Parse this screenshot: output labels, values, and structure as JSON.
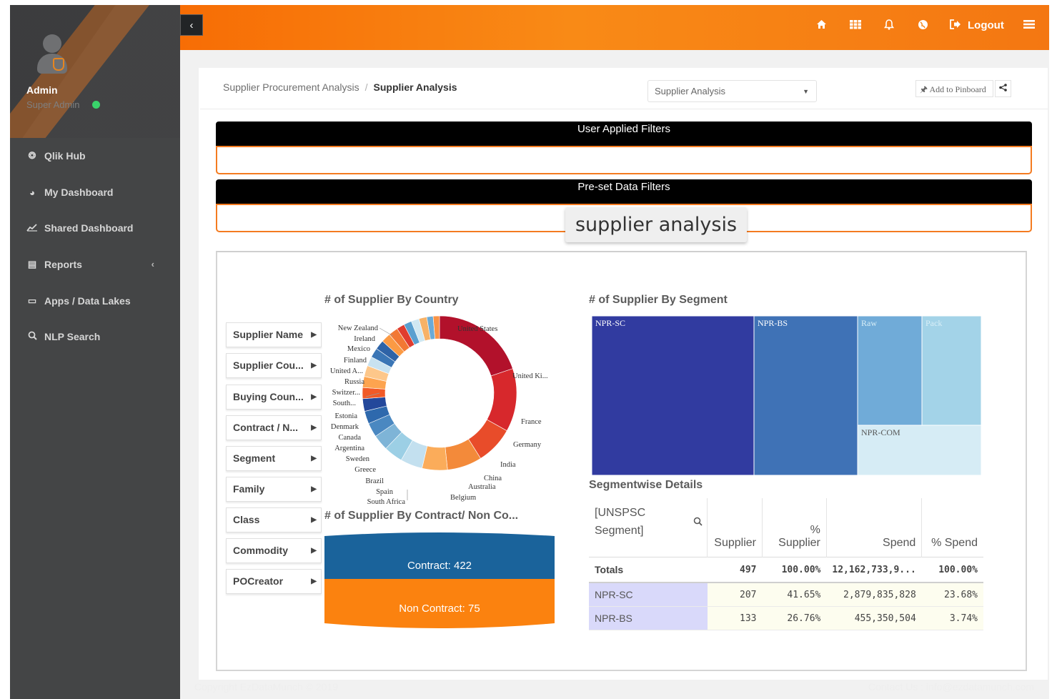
{
  "sidebar": {
    "user_name": "Admin",
    "user_role": "Super Admin",
    "items": [
      {
        "label": "Qlik Hub",
        "icon": "qlik-hub-icon"
      },
      {
        "label": "My Dashboard",
        "icon": "dashboard-icon"
      },
      {
        "label": "Shared Dashboard",
        "icon": "line-chart-icon"
      },
      {
        "label": "Reports",
        "icon": "report-icon"
      },
      {
        "label": "Apps / Data Lakes",
        "icon": "monitor-icon"
      },
      {
        "label": "NLP Search",
        "icon": "search-icon"
      }
    ]
  },
  "topbar": {
    "logout_label": "Logout",
    "icons": [
      "home-icon",
      "grid-icon",
      "bell-icon",
      "globe-icon",
      "logout-icon",
      "menu-icon"
    ]
  },
  "breadcrumb": {
    "parent": "Supplier Procurement Analysis",
    "current": "Supplier Analysis"
  },
  "sheet_select": {
    "value": "Supplier Analysis"
  },
  "pinboard_label": "Add to Pinboard",
  "filters": {
    "user_applied_title": "User Applied Filters",
    "preset_title": "Pre-set Data Filters"
  },
  "tooltip_text": "supplier analysis",
  "listboxes": [
    "Supplier Name",
    "Supplier Cou...",
    "Buying Coun...",
    "Contract / N...",
    "Segment",
    "Family",
    "Class",
    "Commodity",
    "POCreator"
  ],
  "country_chart": {
    "title": "# of Supplier By Country",
    "labels_left": [
      "New Zealand",
      "Ireland",
      "Mexico",
      "Finland",
      "United A...",
      "Russia",
      "Switzer...",
      "South...",
      "Estonia",
      "Denmark",
      "Canada",
      "Argentina",
      "Sweden",
      "Greece",
      "Brazil",
      "Spain",
      "South Africa"
    ],
    "labels_right": [
      "United States",
      "United Ki...",
      "France",
      "Germany",
      "India",
      "China",
      "Australia",
      "Belgium"
    ]
  },
  "segment_chart": {
    "title": "# of Supplier By Segment",
    "tiles": [
      "NPR-SC",
      "NPR-BS",
      "Raw",
      "Pack",
      "NPR-COM"
    ]
  },
  "contract_chart": {
    "title": "# of Supplier By Contract/ Non Co...",
    "contract_label": "Contract: 422",
    "noncontract_label": "Non Contract: 75"
  },
  "chart_data": [
    {
      "type": "pie",
      "title": "# of Supplier By Country",
      "categories": [
        "United States",
        "United Ki...",
        "France",
        "Germany",
        "India",
        "China",
        "Australia",
        "Belgium",
        "South Africa",
        "Spain",
        "Brazil",
        "Greece",
        "Sweden",
        "Argentina",
        "Canada",
        "Denmark",
        "Estonia",
        "South...",
        "Switzer...",
        "Russia",
        "United A...",
        "Finland",
        "Mexico",
        "Ireland",
        "New Zealand"
      ],
      "values": [
        60,
        40,
        24,
        22,
        16,
        14,
        12,
        10,
        9,
        8,
        8,
        7,
        7,
        7,
        6,
        6,
        6,
        6,
        6,
        5,
        5,
        5,
        5,
        4,
        4
      ]
    },
    {
      "type": "heatmap",
      "title": "# of Supplier By Segment",
      "categories": [
        "NPR-SC",
        "NPR-BS",
        "Raw",
        "Pack",
        "NPR-COM"
      ],
      "values": [
        207,
        133,
        60,
        60,
        37
      ]
    },
    {
      "type": "bar",
      "title": "# of Supplier By Contract/ Non Co...",
      "categories": [
        "Contract",
        "Non Contract"
      ],
      "values": [
        422,
        75
      ]
    }
  ],
  "segment_table": {
    "title": "Segmentwise Details",
    "headers": [
      "[UNSPSC Segment]",
      "Supplier",
      "% Supplier",
      "Spend",
      "% Spend"
    ],
    "totals": [
      "Totals",
      "497",
      "100.00%",
      "12,162,733,9...",
      "100.00%"
    ],
    "rows": [
      [
        "NPR-SC",
        "207",
        "41.65%",
        "2,879,835,828",
        "23.68%"
      ],
      [
        "NPR-BS",
        "133",
        "26.76%",
        "455,350,504",
        "3.74%"
      ]
    ]
  },
  "footer": {
    "copyright": "Copyright EzDataMunch © 2019",
    "contact": "Contact Us : info@ezdatamunch.com"
  }
}
